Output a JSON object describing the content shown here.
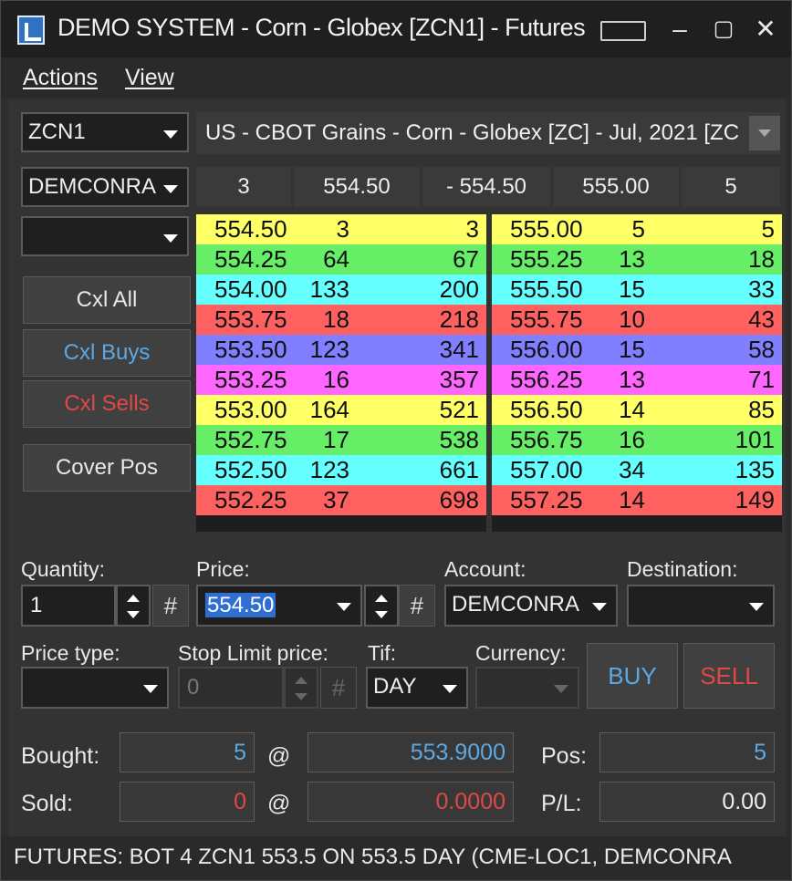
{
  "window": {
    "title": "DEMO SYSTEM - Corn - Globex [ZCN1] - Futures"
  },
  "menu": {
    "actions": "Actions",
    "view": "View"
  },
  "symbol": {
    "value": "ZCN1"
  },
  "contract_description": "US - CBOT Grains - Corn - Globex [ZC] - Jul, 2021 [ZC",
  "account_combo": {
    "value": "DEMCONRA"
  },
  "blank_combo": {
    "value": ""
  },
  "quote_bar": {
    "bid_size": "3",
    "bid_price": "554.50",
    "change": "- 554.50",
    "ask_price": "555.00",
    "ask_size": "5"
  },
  "side_buttons": {
    "cxl_all": "Cxl All",
    "cxl_buys": "Cxl Buys",
    "cxl_sells": "Cxl Sells",
    "cover_pos": "Cover Pos"
  },
  "bids": [
    {
      "price": "554.50",
      "size": "3",
      "cum": "3",
      "color": "#ffff66"
    },
    {
      "price": "554.25",
      "size": "64",
      "cum": "67",
      "color": "#66ee66"
    },
    {
      "price": "554.00",
      "size": "133",
      "cum": "200",
      "color": "#66ffff"
    },
    {
      "price": "553.75",
      "size": "18",
      "cum": "218",
      "color": "#ff6060"
    },
    {
      "price": "553.50",
      "size": "123",
      "cum": "341",
      "color": "#7f7fff"
    },
    {
      "price": "553.25",
      "size": "16",
      "cum": "357",
      "color": "#ff66ff"
    },
    {
      "price": "553.00",
      "size": "164",
      "cum": "521",
      "color": "#ffff66"
    },
    {
      "price": "552.75",
      "size": "17",
      "cum": "538",
      "color": "#66ee66"
    },
    {
      "price": "552.50",
      "size": "123",
      "cum": "661",
      "color": "#66ffff"
    },
    {
      "price": "552.25",
      "size": "37",
      "cum": "698",
      "color": "#ff6060"
    }
  ],
  "asks": [
    {
      "price": "555.00",
      "size": "5",
      "cum": "5",
      "color": "#ffff66"
    },
    {
      "price": "555.25",
      "size": "13",
      "cum": "18",
      "color": "#66ee66"
    },
    {
      "price": "555.50",
      "size": "15",
      "cum": "33",
      "color": "#66ffff"
    },
    {
      "price": "555.75",
      "size": "10",
      "cum": "43",
      "color": "#ff6060"
    },
    {
      "price": "556.00",
      "size": "15",
      "cum": "58",
      "color": "#7f7fff"
    },
    {
      "price": "556.25",
      "size": "13",
      "cum": "71",
      "color": "#ff66ff"
    },
    {
      "price": "556.50",
      "size": "14",
      "cum": "85",
      "color": "#ffff66"
    },
    {
      "price": "556.75",
      "size": "16",
      "cum": "101",
      "color": "#66ee66"
    },
    {
      "price": "557.00",
      "size": "34",
      "cum": "135",
      "color": "#66ffff"
    },
    {
      "price": "557.25",
      "size": "14",
      "cum": "149",
      "color": "#ff6060"
    }
  ],
  "order": {
    "quantity_label": "Quantity:",
    "quantity": "1",
    "price_label": "Price:",
    "price": "554.50",
    "account_label": "Account:",
    "account": "DEMCONRA",
    "destination_label": "Destination:",
    "destination": "",
    "price_type_label": "Price type:",
    "price_type": "",
    "stop_limit_label": "Stop Limit price:",
    "stop_limit": "0",
    "tif_label": "Tif:",
    "tif": "DAY",
    "currency_label": "Currency:",
    "currency": "",
    "hash": "#",
    "buy": "BUY",
    "sell": "SELL"
  },
  "summary": {
    "bought_label": "Bought:",
    "bought_qty": "5",
    "bought_at": "@",
    "bought_price": "553.9000",
    "sold_label": "Sold:",
    "sold_qty": "0",
    "sold_at": "@",
    "sold_price": "0.0000",
    "pos_label": "Pos:",
    "pos": "5",
    "pl_label": "P/L:",
    "pl": "0.00"
  },
  "status": "FUTURES: BOT 4 ZCN1 553.5 ON 553.5  DAY (CME-LOC1, DEMCONRA",
  "colors": {
    "buy_blue": "#5aa9e6",
    "sell_red": "#e04848"
  }
}
